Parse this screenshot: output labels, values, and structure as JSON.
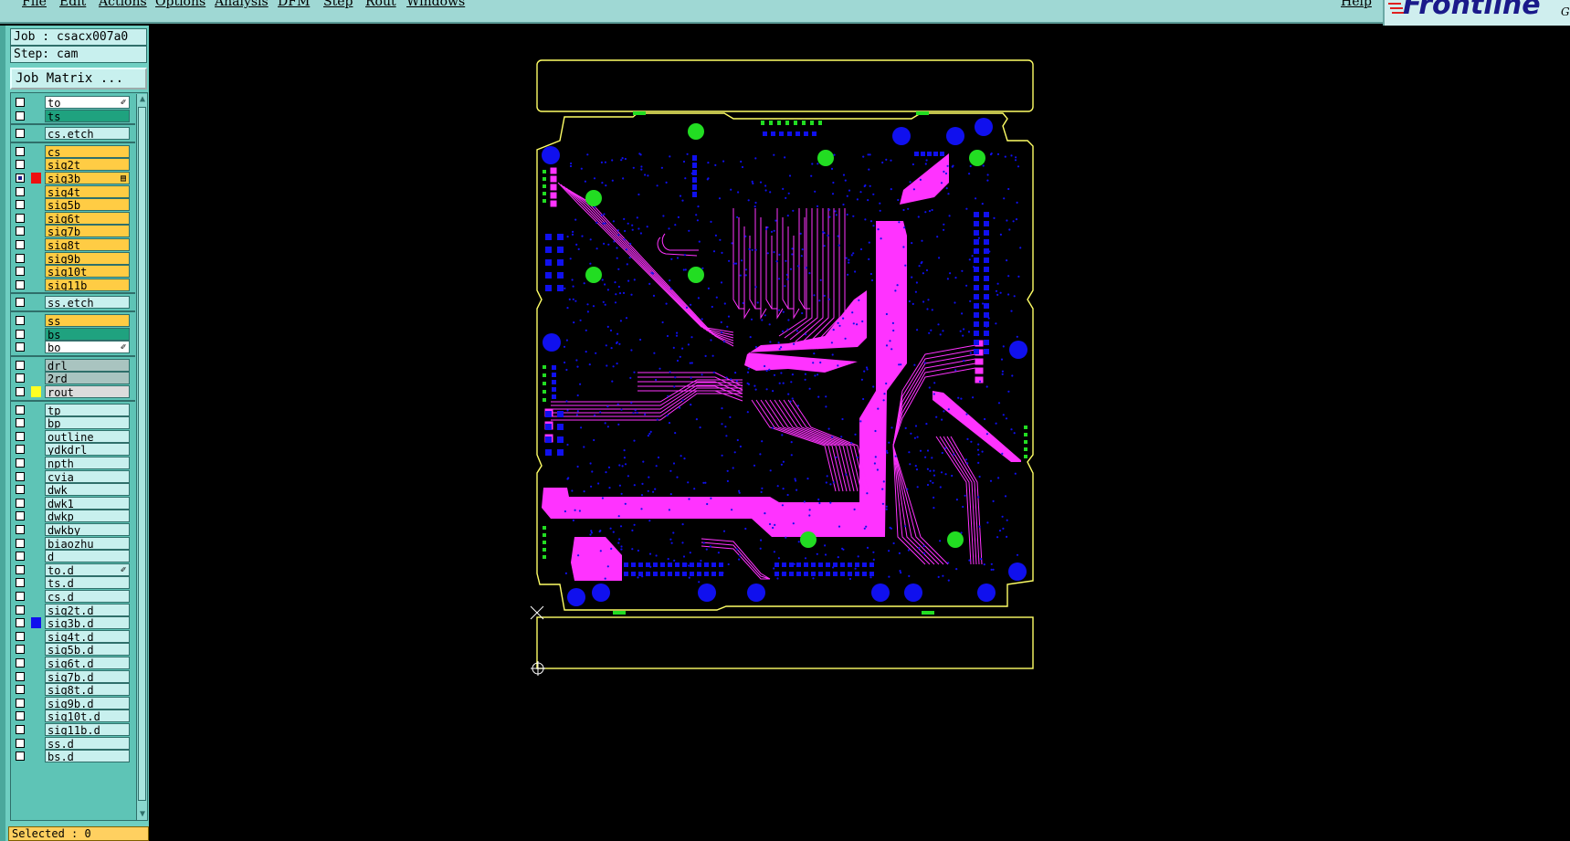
{
  "menu": {
    "items": [
      "File",
      "Edit",
      "Actions",
      "Options",
      "Analysis",
      "DFM",
      "Step",
      "Rout",
      "Windows"
    ],
    "help": "Help"
  },
  "logo": {
    "text": "Frontline",
    "sub": "G"
  },
  "job_label": "Job : csacx007a0",
  "step_label": "Step: cam",
  "job_matrix_label": "Job Matrix ...",
  "selected_label": "Selected : 0",
  "colors": {
    "board_outline": "#ffff66",
    "trace": "#ff33ff",
    "pad_blue": "#1010ee",
    "pad_green": "#22dd22",
    "layer_yellow": "#ffcc44",
    "layer_cyan": "#c8f0ee",
    "layer_teal": "#1fa27f",
    "layer_gray": "#a9c4c0"
  },
  "layers": [
    {
      "name": "to",
      "bg": "white",
      "ind": "✐",
      "color": ""
    },
    {
      "name": "ts",
      "bg": "teal",
      "ind": "",
      "color": ""
    },
    {
      "name": "cs.etch",
      "bg": "cyan",
      "ind": "",
      "color": "",
      "group": true
    },
    {
      "name": "cs",
      "bg": "yellow",
      "ind": "",
      "color": "",
      "group": true
    },
    {
      "name": "sig2t",
      "bg": "yellow",
      "ind": "",
      "color": ""
    },
    {
      "name": "sig3b",
      "bg": "yellow",
      "ind": "▤",
      "color": "red",
      "checked": true
    },
    {
      "name": "sig4t",
      "bg": "yellow",
      "ind": "",
      "color": ""
    },
    {
      "name": "sig5b",
      "bg": "yellow",
      "ind": "",
      "color": ""
    },
    {
      "name": "sig6t",
      "bg": "yellow",
      "ind": "",
      "color": ""
    },
    {
      "name": "sig7b",
      "bg": "yellow",
      "ind": "",
      "color": ""
    },
    {
      "name": "sig8t",
      "bg": "yellow",
      "ind": "",
      "color": ""
    },
    {
      "name": "sig9b",
      "bg": "yellow",
      "ind": "",
      "color": ""
    },
    {
      "name": "sig10t",
      "bg": "yellow",
      "ind": "",
      "color": ""
    },
    {
      "name": "sig11b",
      "bg": "yellow",
      "ind": "",
      "color": ""
    },
    {
      "name": "ss.etch",
      "bg": "cyan",
      "ind": "",
      "color": "",
      "group": true
    },
    {
      "name": "ss",
      "bg": "yellow",
      "ind": "",
      "color": "",
      "group": true
    },
    {
      "name": "bs",
      "bg": "teal",
      "ind": "",
      "color": ""
    },
    {
      "name": "bo",
      "bg": "white",
      "ind": "✐",
      "color": ""
    },
    {
      "name": "drl",
      "bg": "gray",
      "ind": "",
      "color": "",
      "group": true
    },
    {
      "name": "2rd",
      "bg": "gray",
      "ind": "",
      "color": ""
    },
    {
      "name": "rout",
      "bg": "lightgray",
      "ind": "",
      "color": "yellow"
    },
    {
      "name": "tp",
      "bg": "cyan",
      "ind": "",
      "color": "",
      "group": true
    },
    {
      "name": "bp",
      "bg": "cyan",
      "ind": "",
      "color": ""
    },
    {
      "name": "outline",
      "bg": "cyan",
      "ind": "",
      "color": ""
    },
    {
      "name": "ydkdrl",
      "bg": "cyan",
      "ind": "",
      "color": ""
    },
    {
      "name": "npth",
      "bg": "cyan",
      "ind": "",
      "color": ""
    },
    {
      "name": "cvia",
      "bg": "cyan",
      "ind": "",
      "color": ""
    },
    {
      "name": "dwk",
      "bg": "cyan",
      "ind": "",
      "color": ""
    },
    {
      "name": "dwk1",
      "bg": "cyan",
      "ind": "",
      "color": ""
    },
    {
      "name": "dwkp",
      "bg": "cyan",
      "ind": "",
      "color": ""
    },
    {
      "name": "dwkby",
      "bg": "cyan",
      "ind": "",
      "color": ""
    },
    {
      "name": "biaozhu",
      "bg": "cyan",
      "ind": "",
      "color": ""
    },
    {
      "name": "d",
      "bg": "cyan",
      "ind": "",
      "color": ""
    },
    {
      "name": "to.d",
      "bg": "cyan",
      "ind": "✐",
      "color": ""
    },
    {
      "name": "ts.d",
      "bg": "cyan",
      "ind": "",
      "color": ""
    },
    {
      "name": "cs.d",
      "bg": "cyan",
      "ind": "",
      "color": ""
    },
    {
      "name": "sig2t.d",
      "bg": "cyan",
      "ind": "",
      "color": ""
    },
    {
      "name": "sig3b.d",
      "bg": "cyan",
      "ind": "",
      "color": "blue"
    },
    {
      "name": "sig4t.d",
      "bg": "cyan",
      "ind": "",
      "color": ""
    },
    {
      "name": "sig5b.d",
      "bg": "cyan",
      "ind": "",
      "color": ""
    },
    {
      "name": "sig6t.d",
      "bg": "cyan",
      "ind": "",
      "color": ""
    },
    {
      "name": "sig7b.d",
      "bg": "cyan",
      "ind": "",
      "color": ""
    },
    {
      "name": "sig8t.d",
      "bg": "cyan",
      "ind": "",
      "color": ""
    },
    {
      "name": "sig9b.d",
      "bg": "cyan",
      "ind": "",
      "color": ""
    },
    {
      "name": "sig10t.d",
      "bg": "cyan",
      "ind": "",
      "color": ""
    },
    {
      "name": "sig11b.d",
      "bg": "cyan",
      "ind": "",
      "color": ""
    },
    {
      "name": "ss.d",
      "bg": "cyan",
      "ind": "",
      "color": ""
    },
    {
      "name": "bs.d",
      "bg": "cyan",
      "ind": "",
      "color": ""
    }
  ]
}
